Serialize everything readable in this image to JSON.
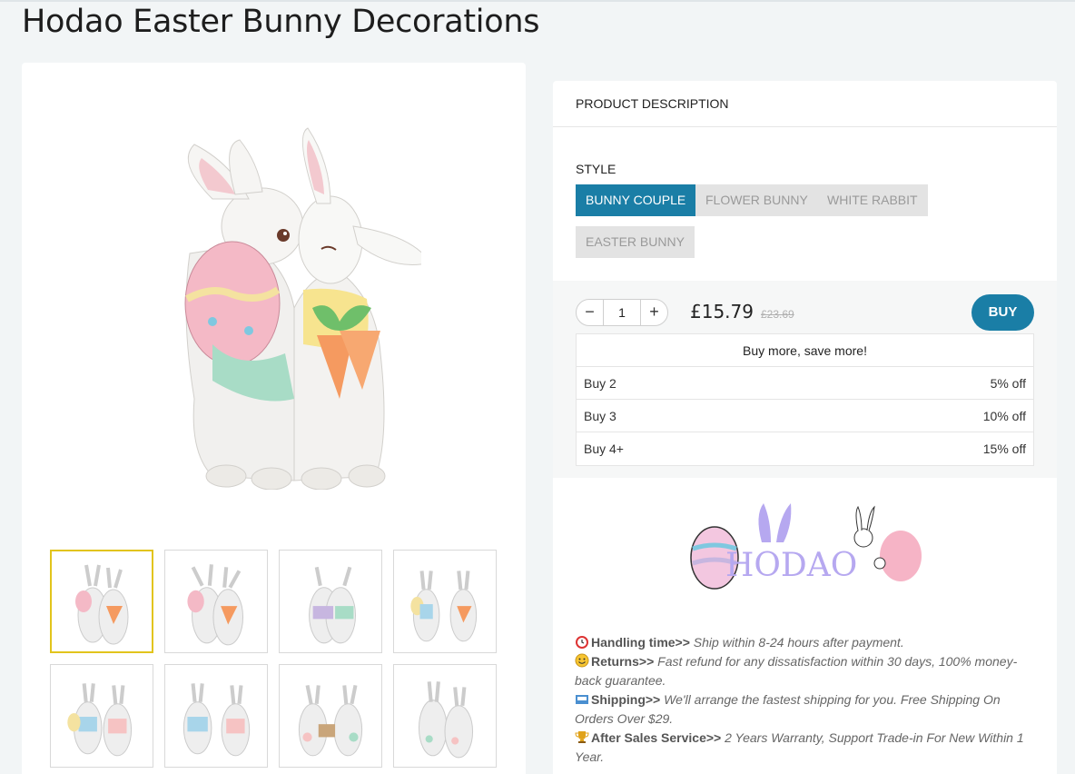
{
  "product": {
    "title": "Hodao Easter Bunny Decorations"
  },
  "description": {
    "header": "PRODUCT DESCRIPTION"
  },
  "style": {
    "label": "STYLE",
    "options": [
      "BUNNY COUPLE",
      "FLOWER BUNNY",
      "WHITE RABBIT",
      "EASTER BUNNY"
    ],
    "selected": "BUNNY COUPLE"
  },
  "purchase": {
    "quantity": "1",
    "minus": "−",
    "plus": "+",
    "price": "£15.79",
    "old_price": "£23.69",
    "buy_label": "BUY"
  },
  "tiers": {
    "header": "Buy more, save more!",
    "rows": [
      {
        "qty": "Buy 2",
        "discount": "5% off"
      },
      {
        "qty": "Buy 3",
        "discount": "10% off"
      },
      {
        "qty": "Buy 4+",
        "discount": "15% off"
      }
    ]
  },
  "brand": {
    "logo_text": "HODAO"
  },
  "info": {
    "handling_label": "Handling time>>",
    "handling_text": " Ship within 8-24 hours after payment.",
    "returns_label": "Returns>>",
    "returns_text": " Fast refund for any dissatisfaction within 30 days, 100% money-back guarantee.",
    "shipping_label": "Shipping>>",
    "shipping_text": " We'll arrange the fastest shipping for you. Free Shipping On Orders Over $29.",
    "aftersales_label": "After Sales Service>>",
    "aftersales_text": " 2 Years Warranty, Support Trade-in For New Within 1 Year."
  },
  "icons": {
    "handling": "alarm-clock-icon",
    "returns": "smiley-icon",
    "shipping": "shipping-box-icon",
    "aftersales": "trophy-icon"
  },
  "colors": {
    "accent": "#1a7ea6",
    "thumb_active": "#e2c41c",
    "option_bg": "#e3e3e3"
  }
}
